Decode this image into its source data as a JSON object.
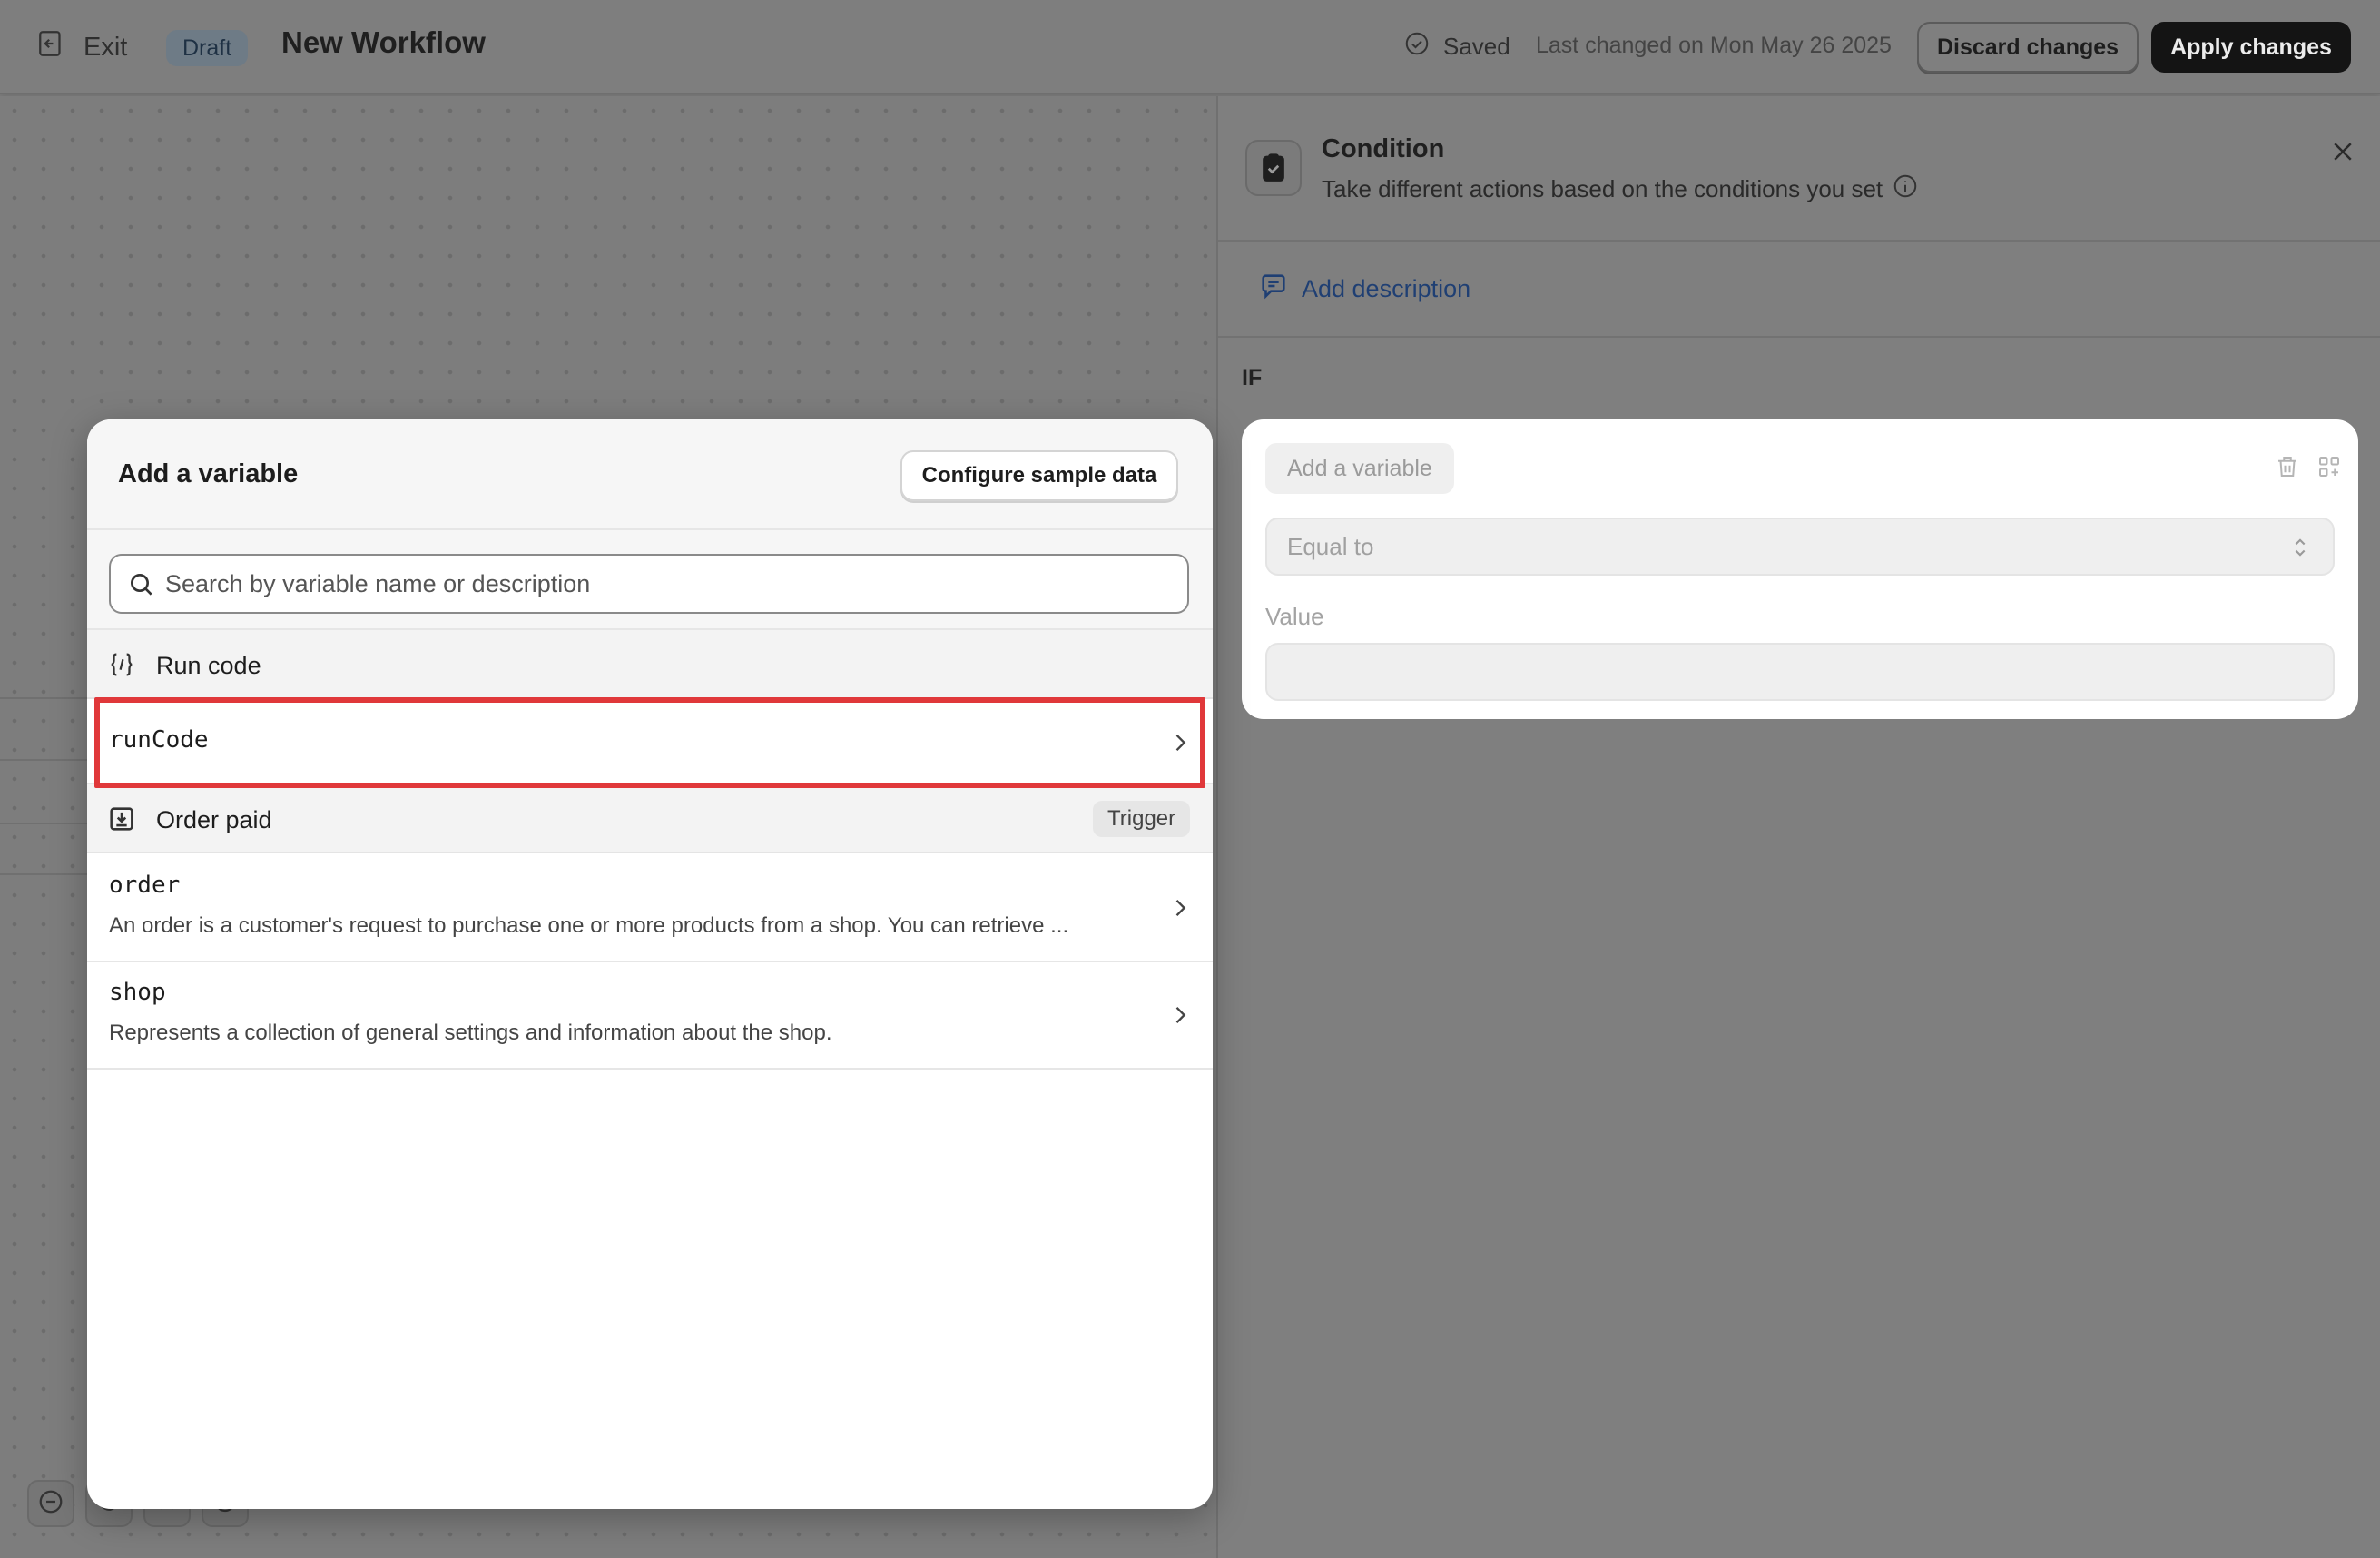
{
  "topbar": {
    "exit_label": "Exit",
    "status_badge": "Draft",
    "title": "New Workflow",
    "saved_label": "Saved",
    "last_changed": "Last changed on Mon May 26 2025",
    "discard_label": "Discard changes",
    "apply_label": "Apply changes"
  },
  "panel": {
    "title": "Condition",
    "subtitle": "Take different actions based on the conditions you set",
    "add_description": "Add description",
    "if_label": "IF",
    "condition": {
      "add_variable": "Add a variable",
      "operator": "Equal to",
      "value_label": "Value",
      "value": ""
    }
  },
  "popover": {
    "title": "Add a variable",
    "configure_label": "Configure sample data",
    "search_placeholder": "Search by variable name or description",
    "sections": [
      {
        "label": "Run code",
        "icon": "code-braces-icon",
        "items": [
          {
            "name": "runCode",
            "description": ""
          }
        ]
      },
      {
        "label": "Order paid",
        "icon": "download-box-icon",
        "badge": "Trigger",
        "items": [
          {
            "name": "order",
            "description": "An order is a customer's request to purchase one or more products from a shop. You can retrieve ..."
          },
          {
            "name": "shop",
            "description": "Represents a collection of general settings and information about the shop."
          }
        ]
      }
    ]
  },
  "colors": {
    "highlight": "#e0383a",
    "link": "#1f3f73",
    "primary_button": "#141414"
  }
}
